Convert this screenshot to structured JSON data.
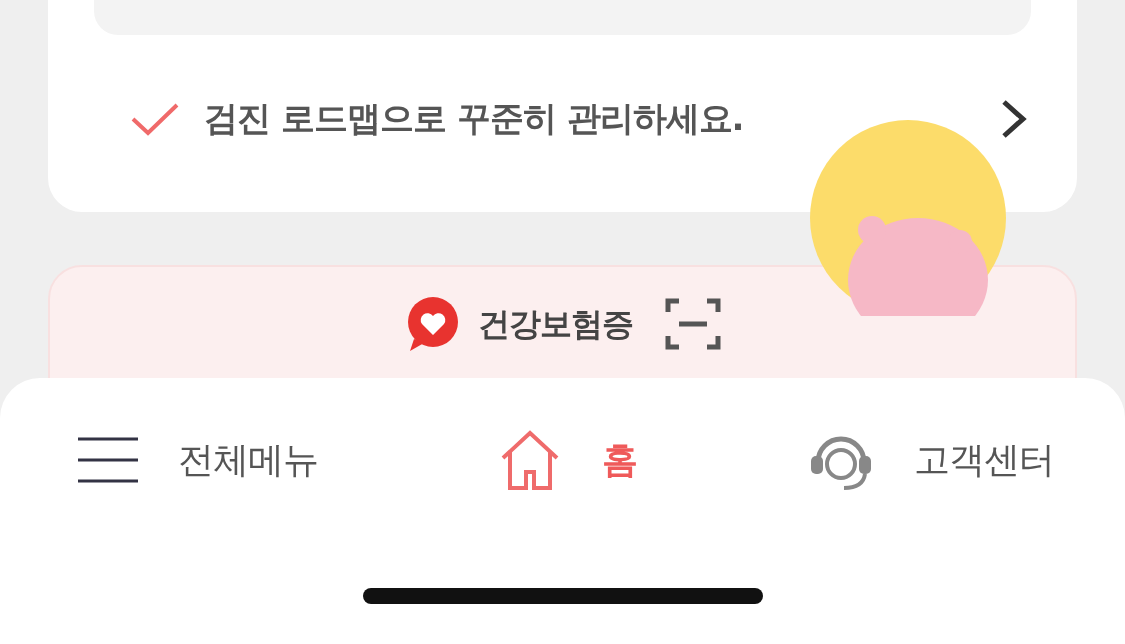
{
  "notice": {
    "text": "검진 로드맵으로 꾸준히 관리하세요."
  },
  "insurance_card": {
    "title": "건강보험증"
  },
  "bottom_nav": [
    {
      "label": "전체메뉴",
      "kind": "menu",
      "selected": false
    },
    {
      "label": "홈",
      "kind": "home",
      "selected": true
    },
    {
      "label": "고객센터",
      "kind": "support",
      "selected": false
    }
  ]
}
